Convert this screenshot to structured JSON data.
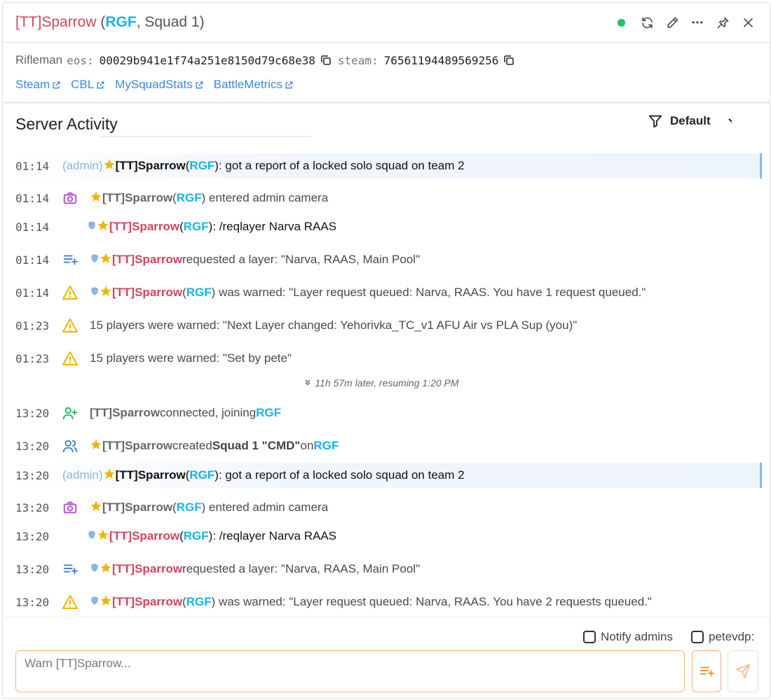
{
  "header": {
    "name": "[TT]Sparrow",
    "paren_open": " (",
    "team": "RGF",
    "squad": ", Squad 1)",
    "status_color": "#1fc45e",
    "icons": [
      "status-online",
      "refresh-icon",
      "edit-icon",
      "more-icon",
      "pin-icon",
      "close-icon"
    ]
  },
  "info": {
    "role": "Rifleman",
    "eos_label": "eos:",
    "eos_value": "00029b941e1f74a251e8150d79c68e38",
    "steam_label": "steam:",
    "steam_value": "76561194489569256"
  },
  "links": [
    "Steam",
    "CBL",
    "MySquadStats",
    "BattleMetrics"
  ],
  "activity": {
    "title": "Server Activity",
    "filter_label": "Default",
    "gap_note": "11h 57m later, resuming 1:20 PM",
    "rows": [
      {
        "time": "01:14",
        "admin": "(admin)",
        "name": "[TT]Sparrow",
        "paren_open": "(",
        "team": "RGF",
        "text": "): got a report of a locked solo squad on team 2"
      },
      {
        "time": "01:14",
        "name": "[TT]Sparrow",
        "paren_open": "(",
        "team": "RGF",
        "text": ") entered admin camera"
      },
      {
        "time": "01:14",
        "name": "[TT]Sparrow",
        "paren_open": "(",
        "team": "RGF",
        "text": "): /reqlayer Narva RAAS"
      },
      {
        "time": "01:14",
        "name": "[TT]Sparrow",
        "text": " requested a layer: \"Narva, RAAS, Main Pool\""
      },
      {
        "time": "01:14",
        "name": "[TT]Sparrow",
        "paren_open": "(",
        "team": "RGF",
        "text": ") was warned: \"Layer request queued: Narva, RAAS. You have 1 request queued.\""
      },
      {
        "time": "01:23",
        "text": "15 players were warned: \"Next Layer changed: Yehorivka_TC_v1 AFU Air vs PLA Sup (you)\""
      },
      {
        "time": "01:23",
        "text": "15 players were warned: \"Set by pete\""
      },
      {
        "time": "13:20",
        "name": "[TT]Sparrow",
        "text": " connected, joining ",
        "team": "RGF"
      },
      {
        "time": "13:20",
        "name": "[TT]Sparrow",
        "text": " created ",
        "squad": "Squad 1 \"CMD\"",
        "text2": " on ",
        "team": "RGF"
      },
      {
        "time": "13:20",
        "admin": "(admin)",
        "name": "[TT]Sparrow",
        "paren_open": "(",
        "team": "RGF",
        "text": "): got a report of a locked solo squad on team 2"
      },
      {
        "time": "13:20",
        "name": "[TT]Sparrow",
        "paren_open": "(",
        "team": "RGF",
        "text": ") entered admin camera"
      },
      {
        "time": "13:20",
        "name": "[TT]Sparrow",
        "paren_open": "(",
        "team": "RGF",
        "text": "): /reqlayer Narva RAAS"
      },
      {
        "time": "13:20",
        "name": "[TT]Sparrow",
        "text": " requested a layer: \"Narva, RAAS, Main Pool\""
      },
      {
        "time": "13:20",
        "name": "[TT]Sparrow",
        "paren_open": "(",
        "team": "RGF",
        "text": ") was warned: \"Layer request queued: Narva, RAAS. You have 2 requests queued.\""
      }
    ]
  },
  "footer": {
    "notify_label": "Notify admins",
    "user_label": "petevdp:",
    "input_placeholder": "Warn [TT]Sparrow..."
  },
  "colors": {
    "red_name": "#d0445f",
    "team_cyan": "#14b4e8",
    "link_blue": "#3a8ad8",
    "warn_yellow": "#f0b400",
    "camera_purple": "#b04ad8",
    "connect_green": "#22b05a",
    "squad_blue": "#3a7ad8",
    "accent_orange": "#f0a050"
  }
}
